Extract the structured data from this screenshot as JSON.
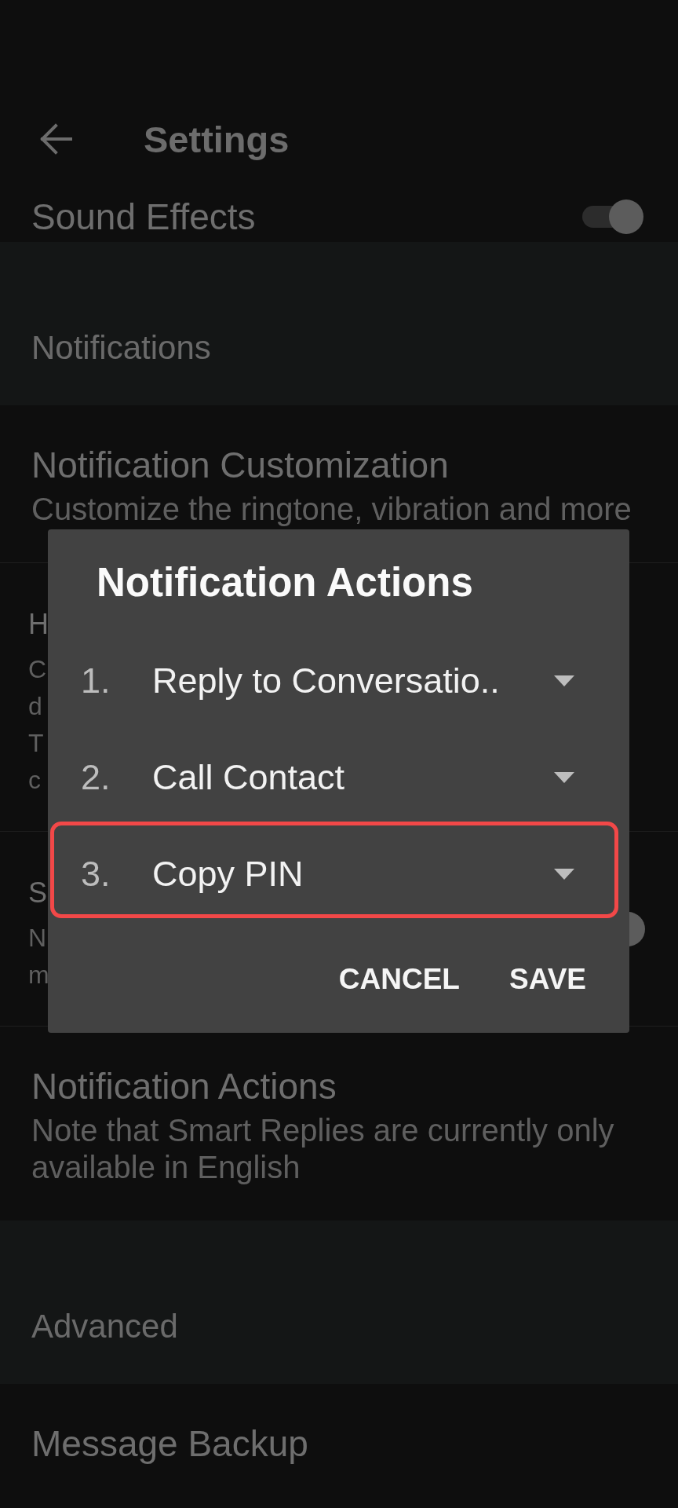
{
  "app_bar": {
    "title": "Settings"
  },
  "settings": [
    {
      "kind": "switch",
      "title": "Sound Effects",
      "on": true
    },
    {
      "kind": "category",
      "title": "Notifications"
    },
    {
      "kind": "item",
      "title": "Notification Customization",
      "summary": "Customize the ringtone, vibration and more"
    },
    {
      "kind": "covered",
      "title": "H",
      "summary_lines": [
        "C",
        "d",
        "T",
        "c"
      ]
    },
    {
      "kind": "covered",
      "title": "S",
      "summary_lines": [
        "N",
        "m"
      ],
      "on": true
    },
    {
      "kind": "item",
      "title": "Notification Actions",
      "summary": "Note that Smart Replies are currently only available in English"
    },
    {
      "kind": "category",
      "title": "Advanced"
    },
    {
      "kind": "item",
      "title": "Message Backup"
    }
  ],
  "dialog": {
    "title": "Notification Actions",
    "actions": [
      {
        "number": "1.",
        "value": "Reply to Conversatio..",
        "highlighted": false
      },
      {
        "number": "2.",
        "value": "Call Contact",
        "highlighted": false
      },
      {
        "number": "3.",
        "value": "Copy PIN",
        "highlighted": true
      }
    ],
    "buttons": [
      "CANCEL",
      "SAVE"
    ]
  }
}
